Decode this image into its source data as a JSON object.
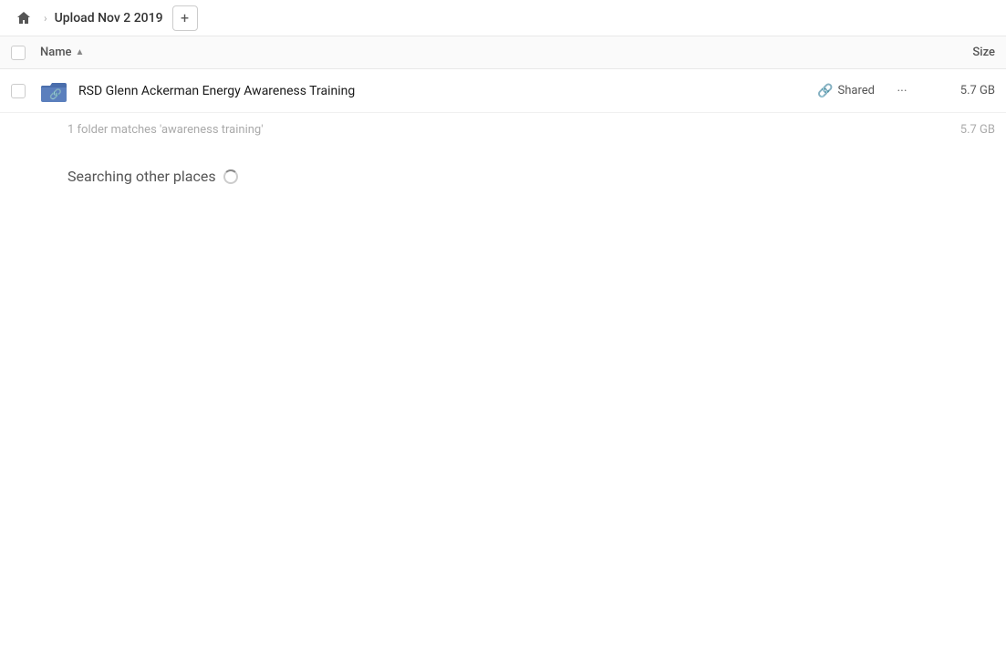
{
  "header": {
    "home_icon": "home",
    "separator": "›",
    "title": "Upload Nov 2 2019",
    "add_icon": "+"
  },
  "columns": {
    "name_label": "Name",
    "sort_indicator": "▲",
    "size_label": "Size"
  },
  "file_row": {
    "icon_color": "#5b7fbd",
    "name": "RSD Glenn Ackerman Energy Awareness Training",
    "shared_label": "Shared",
    "more_icon": "···",
    "size": "5.7 GB"
  },
  "summary": {
    "text": "1 folder matches 'awareness training'",
    "size": "5.7 GB"
  },
  "searching": {
    "label": "Searching other places"
  }
}
